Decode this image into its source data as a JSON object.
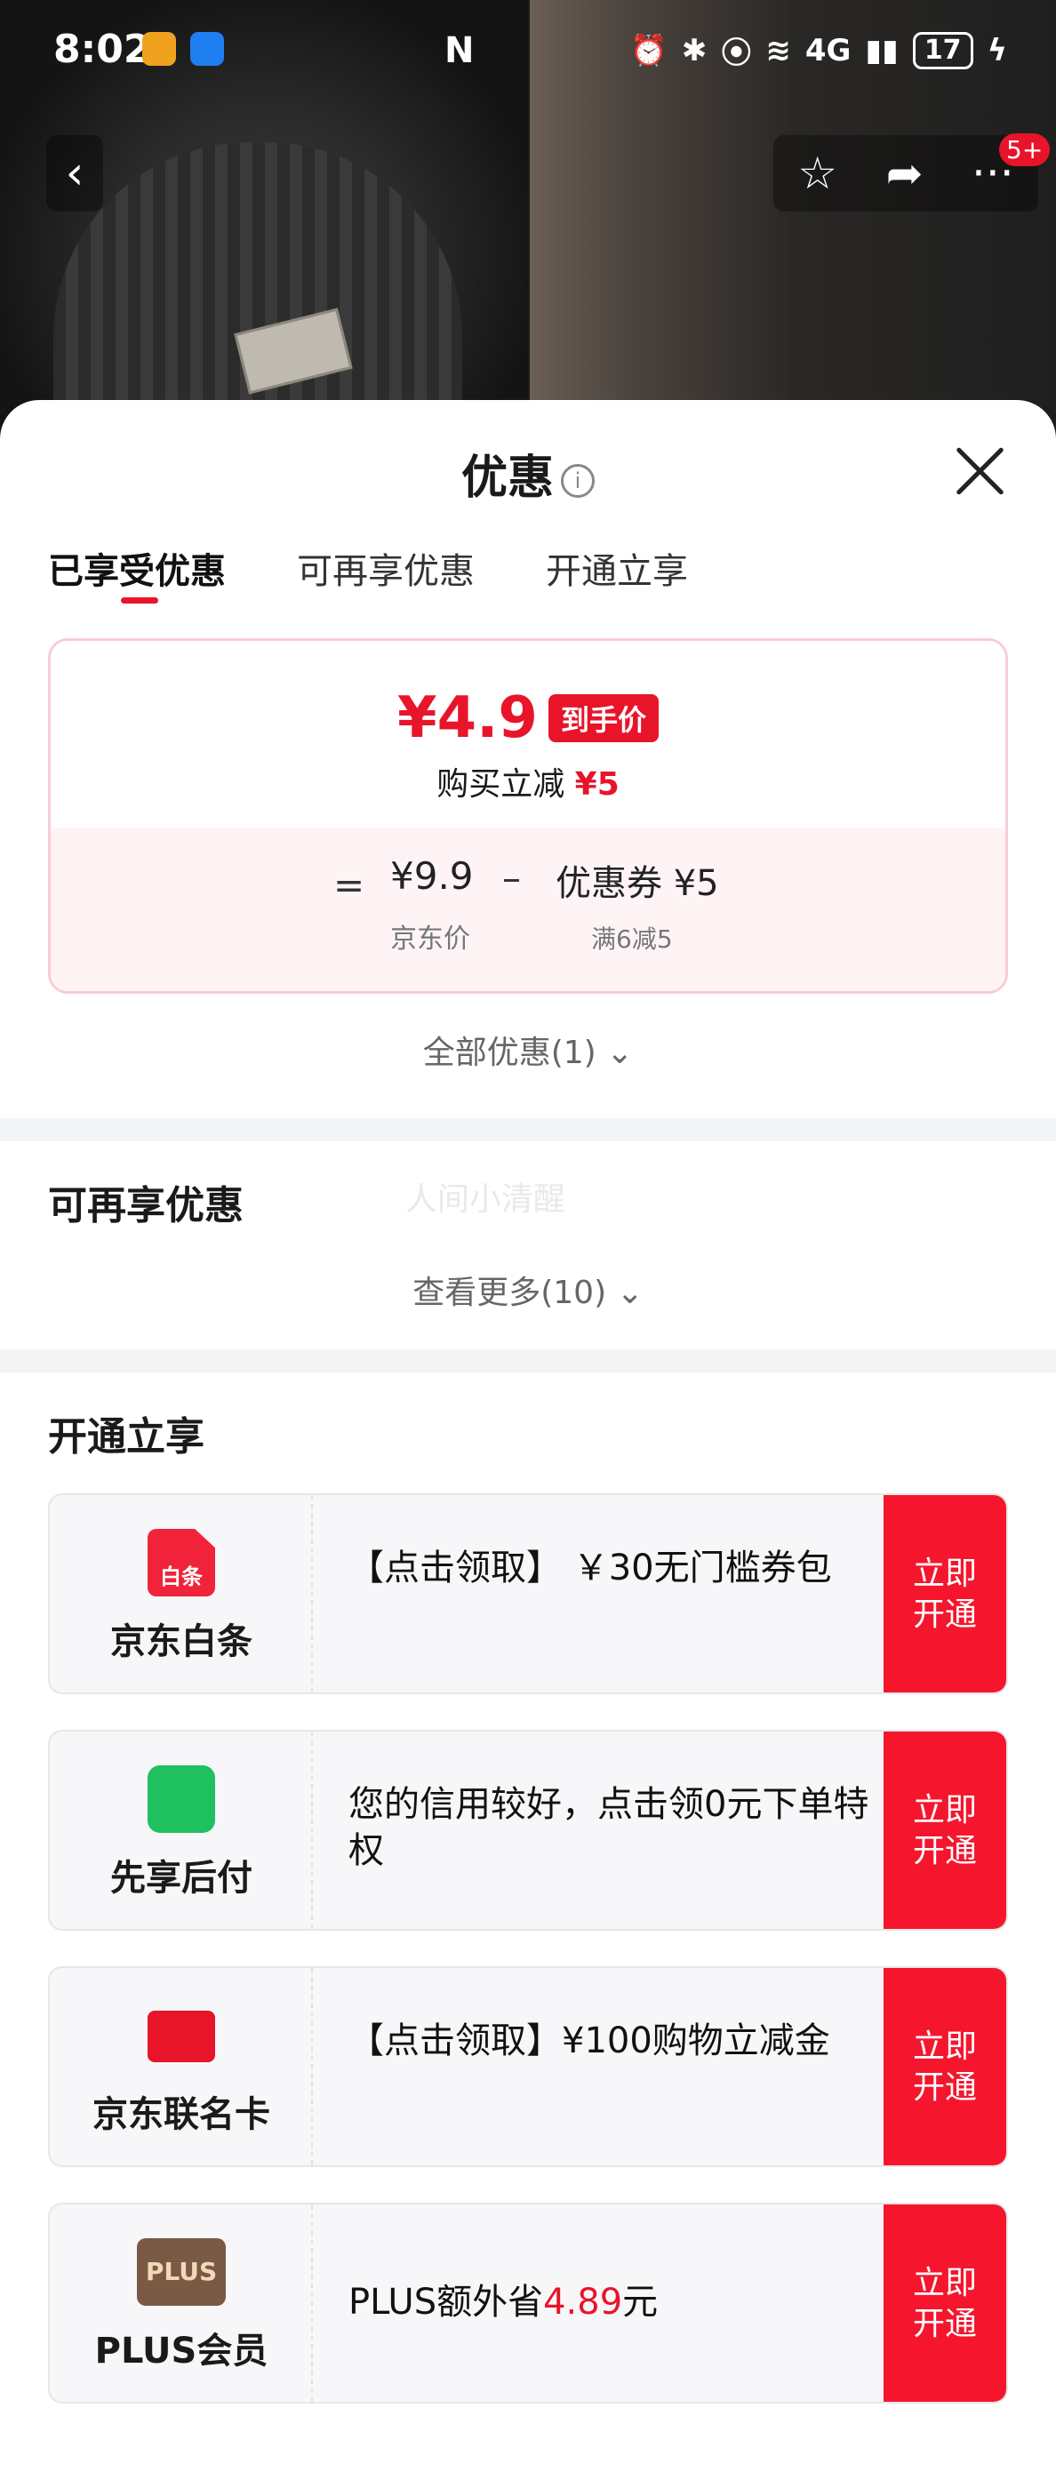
{
  "status_bar": {
    "time": "8:02",
    "nfc": "N",
    "network": "4G",
    "battery": "17"
  },
  "nav": {
    "badge": "5+"
  },
  "sheet": {
    "title": "优惠",
    "tabs": [
      {
        "label": "已享受优惠",
        "active": true
      },
      {
        "label": "可再享优惠",
        "active": false
      },
      {
        "label": "开通立享",
        "active": false
      }
    ],
    "price_card": {
      "final_price": "¥4.9",
      "final_tag": "到手价",
      "instant_reduce_label": "购买立减",
      "instant_reduce_value": "¥5",
      "equals": "=",
      "jd_price": "¥9.9",
      "jd_price_label": "京东价",
      "minus": "–",
      "coupon": "优惠券 ¥5",
      "coupon_condition": "满6减5"
    },
    "all_offers": "全部优惠(1) ⌄",
    "section_more": {
      "title": "可再享优惠",
      "watermark": "人间小清醒",
      "see_more": "查看更多(10) ⌄"
    },
    "section_open": {
      "title": "开通立享",
      "services": [
        {
          "name": "京东白条",
          "icon_text": "白条",
          "desc": "【点击领取】 ￥30无门槛券包",
          "button": "立即\n开通"
        },
        {
          "name": "先享后付",
          "desc": "您的信用较好，点击领0元下单特权",
          "button": "立即\n开通"
        },
        {
          "name": "京东联名卡",
          "desc": "【点击领取】¥100购物立减金",
          "button": "立即\n开通"
        },
        {
          "name": "PLUS会员",
          "icon_text": "PLUS",
          "desc_prefix": "PLUS额外省",
          "desc_amount": "4.89",
          "desc_suffix": "元",
          "button": "立即\n开通"
        }
      ]
    }
  },
  "colors": {
    "accent": "#e8142a",
    "button": "#f5162e",
    "card_border": "#f7cdd3",
    "card_bottom": "#fff4f5"
  }
}
